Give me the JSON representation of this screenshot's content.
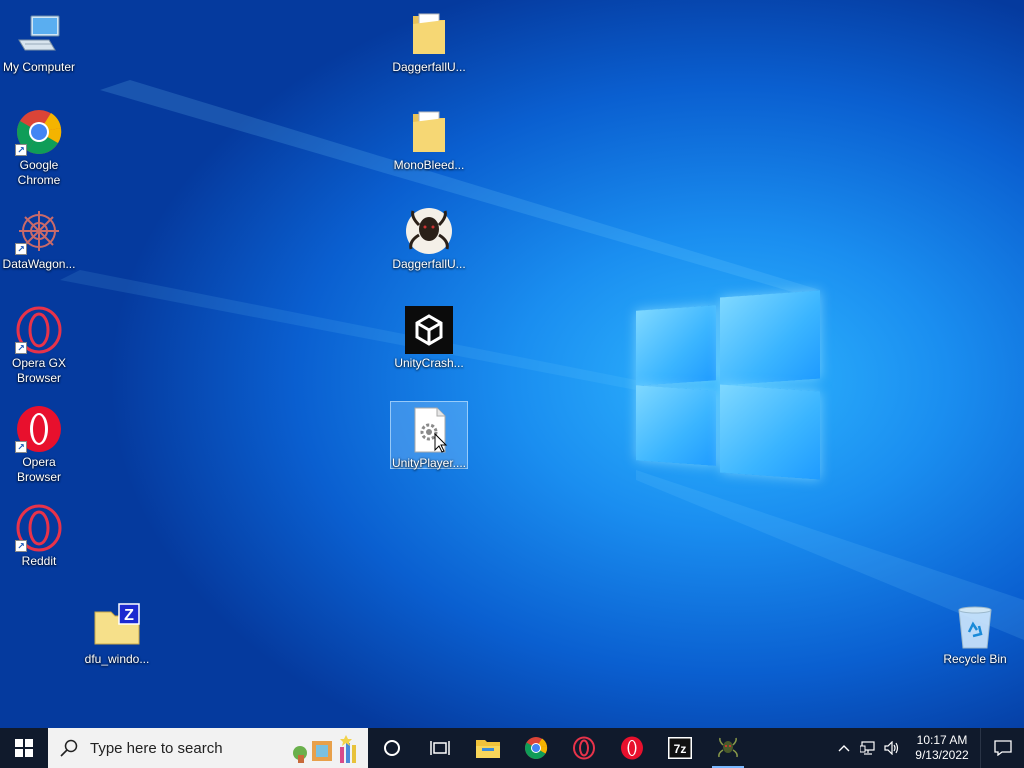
{
  "desktop": {
    "icons": [
      {
        "name": "My Computer",
        "kind": "computer-icon"
      },
      {
        "name": "Google Chrome",
        "kind": "chrome-icon",
        "shortcut": true
      },
      {
        "name": "DataWagon...",
        "kind": "datawagon-icon",
        "shortcut": true
      },
      {
        "name": "Opera GX Browser",
        "kind": "opera-gx-icon",
        "shortcut": true
      },
      {
        "name": "Opera Browser",
        "kind": "opera-icon",
        "shortcut": true
      },
      {
        "name": "Reddit",
        "kind": "opera-gx-icon",
        "shortcut": true
      },
      {
        "name": "dfu_windo...",
        "kind": "zip-folder-icon"
      },
      {
        "name": "DaggerfallU...",
        "kind": "folder-icon"
      },
      {
        "name": "MonoBleed...",
        "kind": "folder-icon"
      },
      {
        "name": "DaggerfallU...",
        "kind": "daggerfall-app-icon"
      },
      {
        "name": "UnityCrash...",
        "kind": "unity-icon"
      },
      {
        "name": "UnityPlayer....",
        "kind": "settings-file-icon",
        "selected": true
      },
      {
        "name": "Recycle Bin",
        "kind": "recycle-bin-icon"
      }
    ]
  },
  "taskbar": {
    "search_placeholder": "Type here to search",
    "pinned": [
      "task-view-icon",
      "file-explorer-icon",
      "chrome-icon",
      "opera-gx-icon",
      "opera-icon",
      "7zip-icon",
      "daggerfall-app-icon"
    ],
    "time": "10:17 AM",
    "date": "9/13/2022"
  },
  "colors": {
    "taskbar": "#101a2c",
    "accent": "#1a8ef0"
  }
}
